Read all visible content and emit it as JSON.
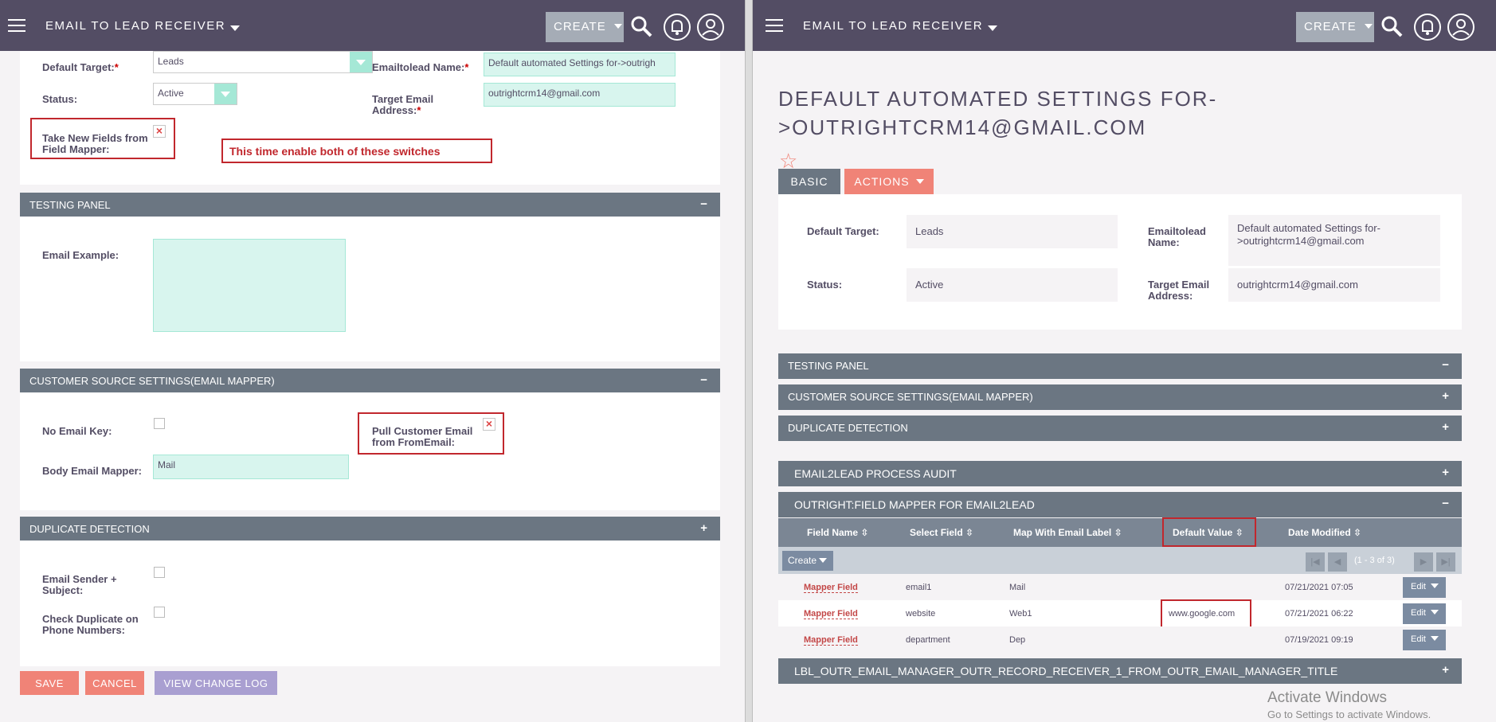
{
  "left": {
    "topbar": {
      "module_title": "EMAIL TO LEAD RECEIVER",
      "create_label": "CREATE"
    },
    "form": {
      "default_target_label": "Default Target:",
      "default_target_value": "Leads",
      "status_label": "Status:",
      "status_value": "Active",
      "emailtolead_name_label": "Emailtolead Name:",
      "emailtolead_name_value": "Default automated Settings for->outrigh",
      "target_email_label": "Target Email Address:",
      "target_email_value": "outrightcrm14@gmail.com",
      "take_new_fields_label": "Take New Fields from Field Mapper:",
      "annotation": "This time enable both of these switches"
    },
    "testing_panel": {
      "title": "TESTING PANEL",
      "toggle": "−",
      "email_example_label": "Email Example:"
    },
    "customer_source": {
      "title": "CUSTOMER SOURCE SETTINGS(EMAIL MAPPER)",
      "toggle": "−",
      "no_email_key_label": "No Email Key:",
      "pull_customer_email_label": "Pull Customer Email from FromEmail:",
      "body_email_mapper_label": "Body Email Mapper:",
      "body_email_mapper_value": "Mail"
    },
    "duplicate_detection": {
      "title": "DUPLICATE DETECTION",
      "toggle": "+",
      "email_sender_label": "Email Sender + Subject:",
      "check_duplicate_label": "Check Duplicate on Phone Numbers:"
    },
    "buttons": {
      "save": "SAVE",
      "cancel": "CANCEL",
      "view_change_log": "VIEW CHANGE LOG"
    }
  },
  "right": {
    "topbar": {
      "module_title": "EMAIL TO LEAD RECEIVER",
      "create_label": "CREATE"
    },
    "title_line1": "DEFAULT AUTOMATED SETTINGS FOR-",
    "title_line2": ">OUTRIGHTCRM14@GMAIL.COM",
    "tabs": {
      "basic": "BASIC",
      "actions": "ACTIONS"
    },
    "detail": {
      "default_target_label": "Default Target:",
      "default_target_value": "Leads",
      "status_label": "Status:",
      "status_value": "Active",
      "emailtolead_name_label": "Emailtolead Name:",
      "emailtolead_name_value_1": "Default automated Settings for-",
      "emailtolead_name_value_2": ">outrightcrm14@gmail.com",
      "target_email_label": "Target Email Address:",
      "target_email_value": "outrightcrm14@gmail.com"
    },
    "panels": {
      "testing": {
        "title": "TESTING PANEL",
        "toggle": "−"
      },
      "customer_source": {
        "title": "CUSTOMER SOURCE SETTINGS(EMAIL MAPPER)",
        "toggle": "+"
      },
      "duplicate": {
        "title": "DUPLICATE DETECTION",
        "toggle": "+"
      },
      "audit": {
        "title": "EMAIL2LEAD PROCESS AUDIT",
        "toggle": "+"
      },
      "field_mapper": {
        "title": "OUTRIGHT:FIELD MAPPER FOR EMAIL2LEAD",
        "toggle": "−"
      },
      "lbl": {
        "title": "LBL_OUTR_EMAIL_MANAGER_OUTR_RECORD_RECEIVER_1_FROM_OUTR_EMAIL_MANAGER_TITLE",
        "toggle": "+"
      }
    },
    "table": {
      "headers": [
        "Field Name",
        "Select Field",
        "Map With Email Label",
        "Default Value",
        "Date Modified"
      ],
      "create_label": "Create",
      "pagination": "(1 - 3 of 3)",
      "edit_label": "Edit",
      "rows": [
        {
          "field_name": "Mapper Field",
          "select_field": "email1",
          "map_label": "Mail",
          "default_value": "",
          "date_modified": "07/21/2021 07:05"
        },
        {
          "field_name": "Mapper Field",
          "select_field": "website",
          "map_label": "Web1",
          "default_value": "www.google.com",
          "date_modified": "07/21/2021 06:22"
        },
        {
          "field_name": "Mapper Field",
          "select_field": "department",
          "map_label": "Dep",
          "default_value": "",
          "date_modified": "07/19/2021 09:19"
        }
      ]
    },
    "watermark": {
      "line1": "Activate Windows",
      "line2": "Go to Settings to activate Windows."
    }
  },
  "colors": {
    "topbar": "#534d64",
    "panel_header": "#6b7682",
    "field_bg": "#d8f5ee",
    "accent_red": "#f08377",
    "annotation_red": "#c1272d",
    "purple_btn": "#a99fd1"
  }
}
